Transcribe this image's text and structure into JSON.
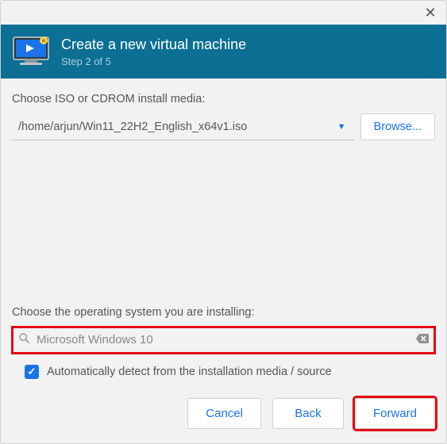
{
  "header": {
    "title": "Create a new virtual machine",
    "step": "Step 2 of 5"
  },
  "iso": {
    "label": "Choose ISO or CDROM install media:",
    "path": "/home/arjun/Win11_22H2_English_x64v1.iso",
    "browse": "Browse..."
  },
  "os": {
    "label": "Choose the operating system you are installing:",
    "search_value": "Microsoft Windows 10",
    "auto_label": "Automatically detect from the installation media / source",
    "auto_checked": true
  },
  "buttons": {
    "cancel": "Cancel",
    "back": "Back",
    "forward": "Forward"
  }
}
